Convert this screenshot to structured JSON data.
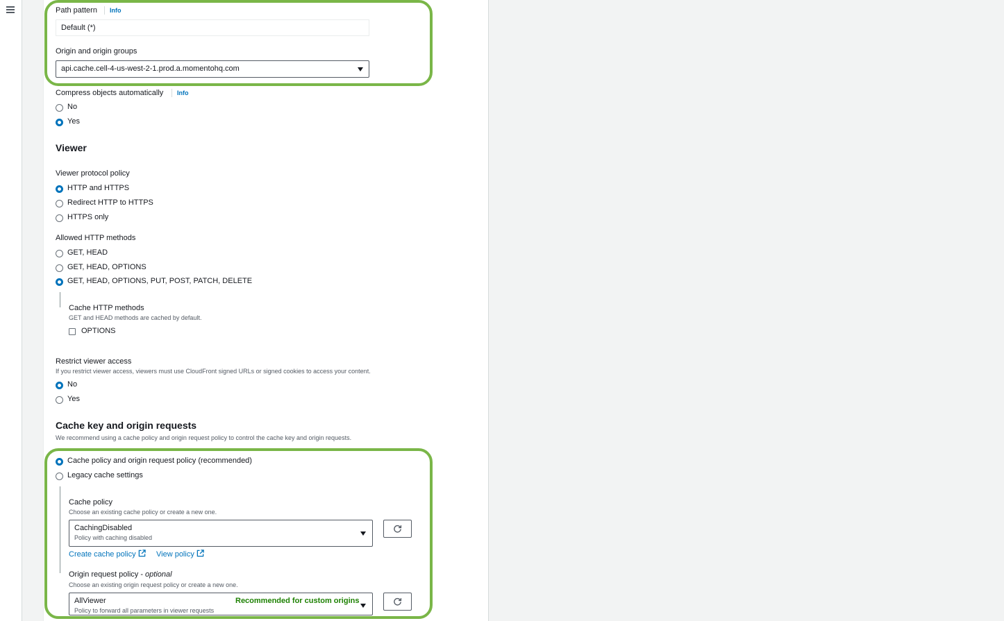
{
  "nav": {
    "menu_icon": "hamburger-menu-icon"
  },
  "path_pattern": {
    "label": "Path pattern",
    "info": "Info",
    "value": "Default (*)"
  },
  "origin": {
    "label": "Origin and origin groups",
    "value": "api.cache.cell-4-us-west-2-1.prod.a.momentohq.com"
  },
  "compress": {
    "label": "Compress objects automatically",
    "info": "Info",
    "options": [
      "No",
      "Yes"
    ],
    "selected": "Yes"
  },
  "viewer": {
    "heading": "Viewer",
    "protocol_label": "Viewer protocol policy",
    "protocol_options": [
      "HTTP and HTTPS",
      "Redirect HTTP to HTTPS",
      "HTTPS only"
    ],
    "protocol_selected": "HTTP and HTTPS",
    "methods_label": "Allowed HTTP methods",
    "methods_options": [
      "GET, HEAD",
      "GET, HEAD, OPTIONS",
      "GET, HEAD, OPTIONS, PUT, POST, PATCH, DELETE"
    ],
    "methods_selected": "GET, HEAD, OPTIONS, PUT, POST, PATCH, DELETE",
    "cache_methods_label": "Cache HTTP methods",
    "cache_methods_desc": "GET and HEAD methods are cached by default.",
    "cache_methods_option": "OPTIONS",
    "restrict_label": "Restrict viewer access",
    "restrict_desc": "If you restrict viewer access, viewers must use CloudFront signed URLs or signed cookies to access your content.",
    "restrict_options": [
      "No",
      "Yes"
    ],
    "restrict_selected": "No"
  },
  "cache_key": {
    "heading": "Cache key and origin requests",
    "desc": "We recommend using a cache policy and origin request policy to control the cache key and origin requests.",
    "options": [
      "Cache policy and origin request policy (recommended)",
      "Legacy cache settings"
    ],
    "selected": "Cache policy and origin request policy (recommended)",
    "cache_policy": {
      "label": "Cache policy",
      "desc": "Choose an existing cache policy or create a new one.",
      "value": "CachingDisabled",
      "value_desc": "Policy with caching disabled",
      "create_link": "Create cache policy",
      "view_link": "View policy"
    },
    "origin_request_policy": {
      "label": "Origin request policy - ",
      "label_suffix": "optional",
      "desc": "Choose an existing origin request policy or create a new one.",
      "value": "AllViewer",
      "value_desc": "Policy to forward all parameters in viewer requests",
      "badge": "Recommended for custom origins"
    }
  },
  "colors": {
    "accent": "#0073bb",
    "highlight": "#7ab648",
    "badge": "#1d8102"
  }
}
